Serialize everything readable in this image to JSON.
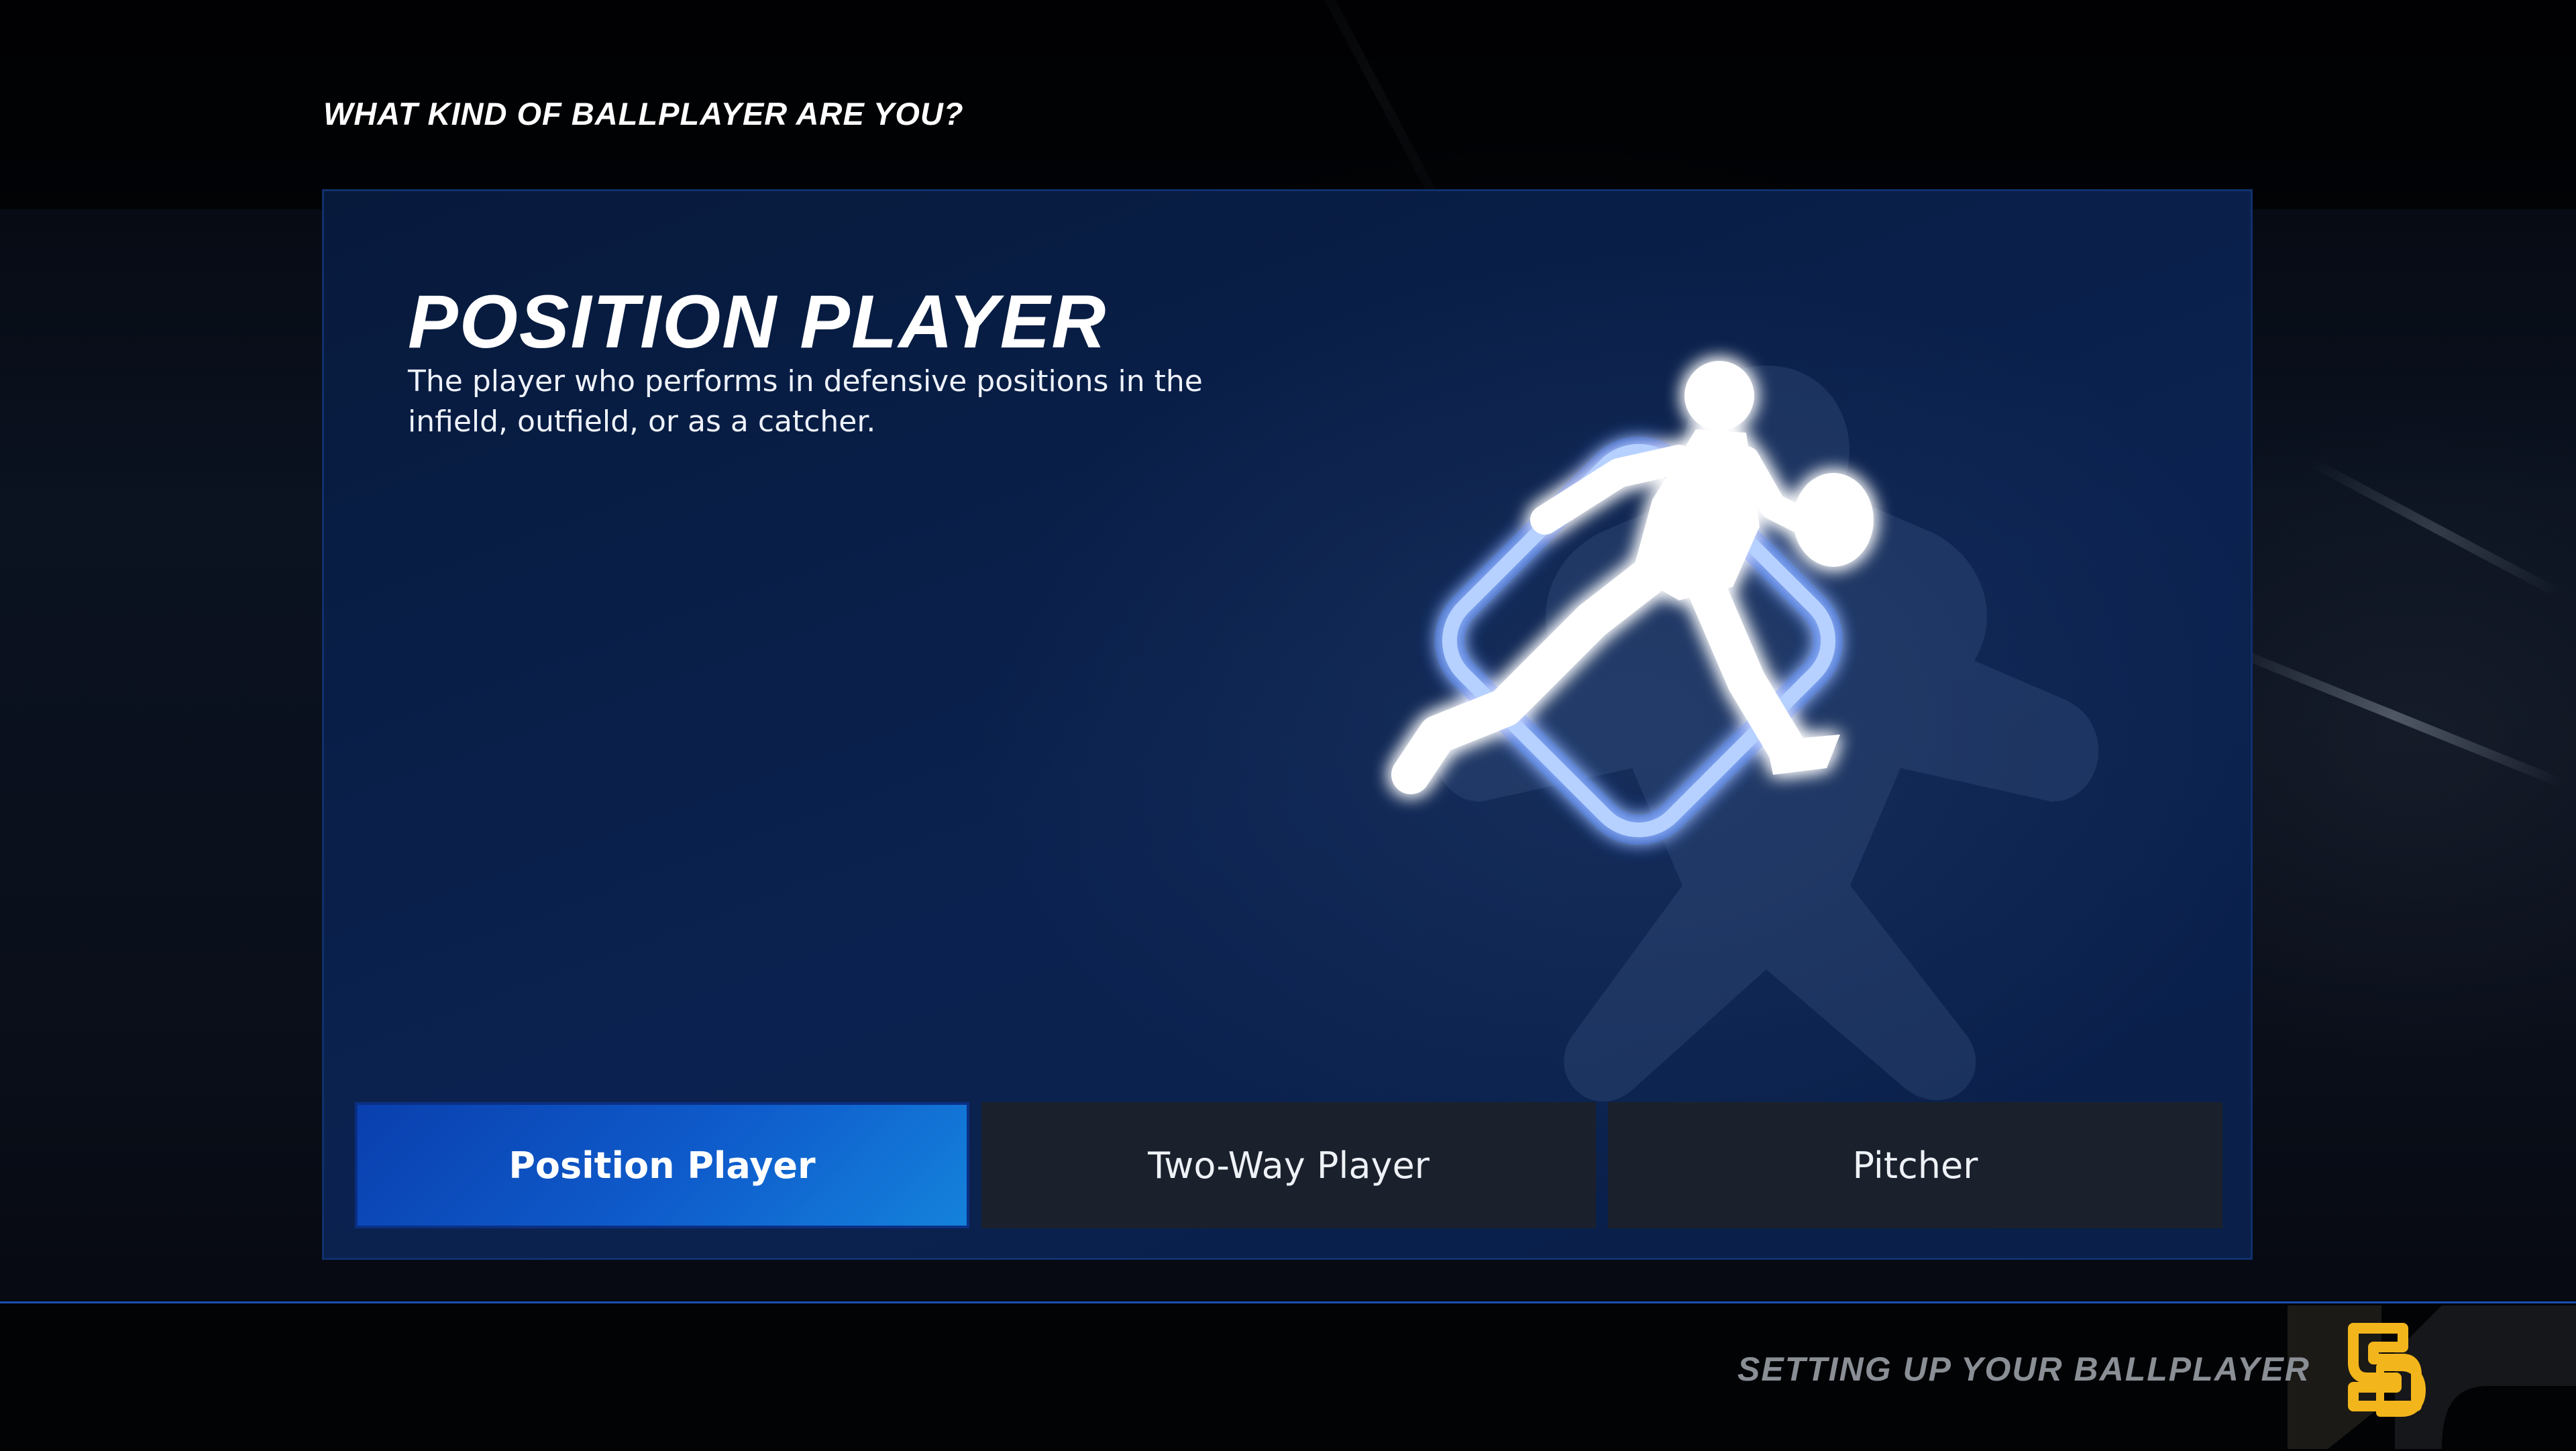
{
  "header": {
    "question": "WHAT KIND OF BALLPLAYER ARE YOU?"
  },
  "panel": {
    "title": "POSITION PLAYER",
    "description": "The player who performs in defensive positions in the infield, outfield, or as a catcher.",
    "emblem_icon": "running-fielder-icon"
  },
  "options": [
    {
      "label": "Position Player",
      "selected": true
    },
    {
      "label": "Two-Way Player",
      "selected": false
    },
    {
      "label": "Pitcher",
      "selected": false
    }
  ],
  "footer": {
    "label": "SETTING UP YOUR BALLPLAYER",
    "team_logo_icon": "sd-team-logo-icon"
  },
  "colors": {
    "accent_blue": "#1565d8",
    "panel_blue": "#0a2250",
    "option_dark": "#1a212c",
    "team_gold": "#f2b51b",
    "footer_text": "#8a8f96"
  }
}
